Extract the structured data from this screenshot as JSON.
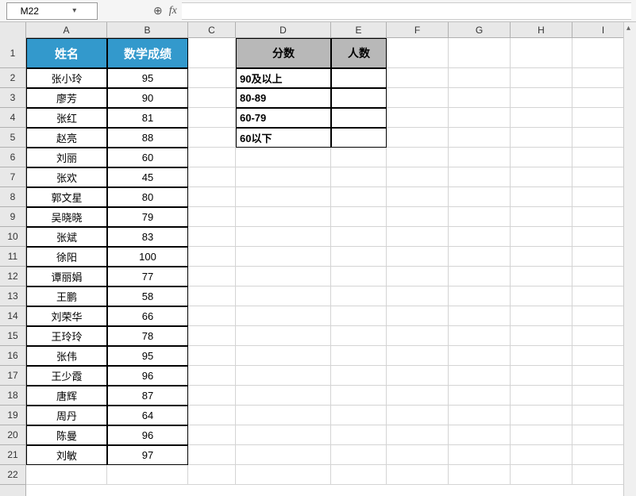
{
  "formula_bar": {
    "cell_reference": "M22",
    "formula": ""
  },
  "columns": [
    "A",
    "B",
    "C",
    "D",
    "E",
    "F",
    "G",
    "H",
    "I"
  ],
  "row_start": 1,
  "row_end": 22,
  "main_table": {
    "header_name": "姓名",
    "header_score": "数学成绩",
    "rows": [
      {
        "name": "张小玲",
        "score": "95"
      },
      {
        "name": "廖芳",
        "score": "90"
      },
      {
        "name": "张红",
        "score": "81"
      },
      {
        "name": "赵亮",
        "score": "88"
      },
      {
        "name": "刘丽",
        "score": "60"
      },
      {
        "name": "张欢",
        "score": "45"
      },
      {
        "name": "郭文星",
        "score": "80"
      },
      {
        "name": "吴晓晓",
        "score": "79"
      },
      {
        "name": "张斌",
        "score": "83"
      },
      {
        "name": "徐阳",
        "score": "100"
      },
      {
        "name": "谭丽娟",
        "score": "77"
      },
      {
        "name": "王鹏",
        "score": "58"
      },
      {
        "name": "刘荣华",
        "score": "66"
      },
      {
        "name": "王玲玲",
        "score": "78"
      },
      {
        "name": "张伟",
        "score": "95"
      },
      {
        "name": "王少霞",
        "score": "96"
      },
      {
        "name": "唐辉",
        "score": "87"
      },
      {
        "name": "周丹",
        "score": "64"
      },
      {
        "name": "陈曼",
        "score": "96"
      },
      {
        "name": "刘敏",
        "score": "97"
      }
    ]
  },
  "summary_table": {
    "header_range": "分数",
    "header_count": "人数",
    "rows": [
      {
        "range": "90及以上",
        "count": ""
      },
      {
        "range": "80-89",
        "count": ""
      },
      {
        "range": "60-79",
        "count": ""
      },
      {
        "range": "60以下",
        "count": ""
      }
    ]
  }
}
